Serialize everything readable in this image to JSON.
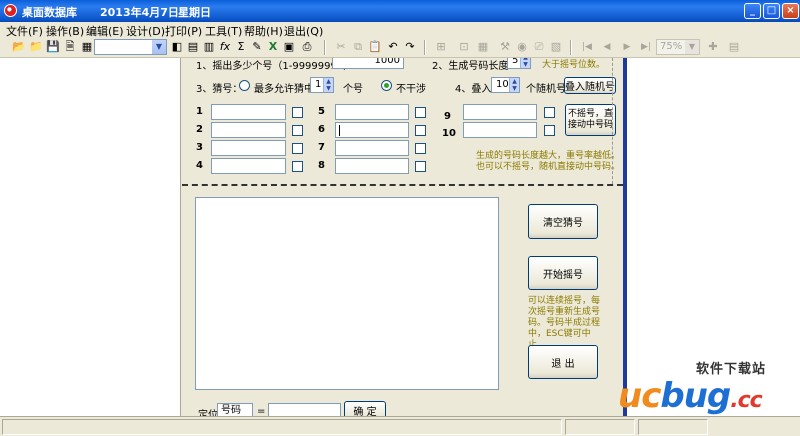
{
  "window": {
    "title": "桌面数据库",
    "date": "2013年4月7日",
    "weekday": "星期日",
    "min_glyph": "_",
    "max_glyph": "□",
    "close_glyph": "×"
  },
  "menu": [
    "文件(F)",
    "操作(B)",
    "编辑(E)",
    "设计(D)",
    "打印(P)",
    "工具(T)",
    "帮助(H)",
    "退出(Q)"
  ],
  "toolbar": {
    "zoom_value": "75%",
    "icons": {
      "open": "📂",
      "folder": "📁",
      "save": "💾",
      "preview": "🗎",
      "grid": "▦",
      "a1": "◧",
      "a2": "▤",
      "a3": "▥",
      "fx": "fx",
      "sigma": "Σ",
      "a4": "✎",
      "excel": "X",
      "a5": "▣",
      "print": "⎙",
      "cut": "✂",
      "copy": "⧉",
      "paste": "📋",
      "undo": "↶",
      "redo": "↷",
      "b1": "⊞",
      "b2": "⊡",
      "b3": "▦",
      "b4": "⚒",
      "b5": "◉",
      "b6": "⎚",
      "b7": "▧",
      "first": "|◀",
      "prev": "◀",
      "next": "▶",
      "last": "▶|",
      "c1": "✚",
      "c2": "▤"
    }
  },
  "form": {
    "q1_label": "1、摇出多少个号（1-99999999）:",
    "q1_value": "1000",
    "q2_label": "2、生成号码长度：",
    "q2_value": "5",
    "q2_note": "大于摇号位数。",
    "q3_label": "3、猜号：",
    "q3_opt1": "最多允许猜中",
    "q3_spin": "1",
    "q3_unit": "个号",
    "q3_opt2": "不干涉",
    "q4_label": "4、叠入",
    "q4_spin": "10",
    "q4_unit": "个随机号",
    "q4_button": "叠入随机号",
    "numbers": [
      "1",
      "2",
      "3",
      "4",
      "5",
      "6",
      "7",
      "8",
      "9",
      "10"
    ],
    "direct_button_line1": "不摇号，直",
    "direct_button_line2": "接动中号码",
    "note1_line1": "生成的号码长度越大，重号率越低。",
    "note1_line2": "也可以不摇号，随机直接动中号码。",
    "clear_button": "清空猜号",
    "start_button": "开始摇号",
    "note2_lines": [
      "可以连续摇号，每",
      "次摇号重新生成号",
      "码。号码半成过程",
      "中，ESC键可中止。"
    ],
    "exit_button": "退  出",
    "locate_label": "定位",
    "locate_field": "号码",
    "locate_eq": "=",
    "confirm_button": "确  定"
  },
  "watermark": {
    "top": "软件下载站",
    "logo_a": "uc",
    "logo_b": "bug",
    "logo_c": ".cc"
  }
}
